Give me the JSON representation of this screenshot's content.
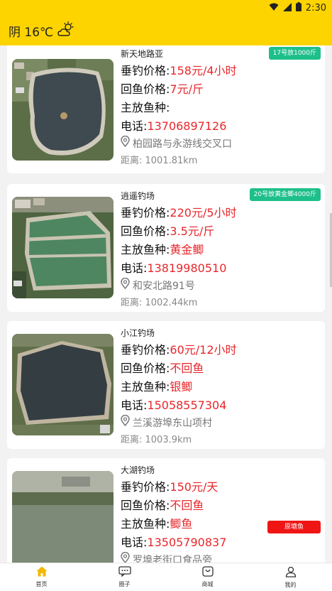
{
  "status_bar": {
    "time": "2:30",
    "icons": [
      "wifi-icon",
      "signal-icon",
      "battery-icon"
    ]
  },
  "header": {
    "weather_text": "阴 16℃",
    "weather_icon": "cloudy-sun-icon",
    "background": "#fdd400"
  },
  "labels": {
    "price_label": "垂钓价格:",
    "return_label": "回鱼价格:",
    "fish_label": "主放鱼种:",
    "phone_label": "电话:",
    "distance_label": "距离: "
  },
  "spots": [
    {
      "name": "新天地路亚",
      "price": "158元/4小时",
      "return_price": "7元/斤",
      "fish": "",
      "phone": "13706897126",
      "address": "柏园路与永游线交叉口",
      "distance": "1001.81km",
      "tag": "17号放1000斤",
      "tag_color": "green"
    },
    {
      "name": "逍遥钓场",
      "price": "220元/5小时",
      "return_price": "3.5元/斤",
      "fish": "黄金鲫",
      "phone": "13819980510",
      "address": "和安北路91号",
      "distance": "1002.44km",
      "tag": "20号放黄金鲫4000斤",
      "tag_color": "green"
    },
    {
      "name": "小江钓场",
      "price": "60元/12小时",
      "return_price": "不回鱼",
      "fish": "银鲫",
      "phone": "15058557304",
      "address": "兰溪游埠东山项村",
      "distance": "1003.9km",
      "tag": "",
      "tag_color": ""
    },
    {
      "name": "大湖钓场",
      "price": "150元/天",
      "return_price": "不回鱼",
      "fish": "鲫鱼",
      "phone": "13505790837",
      "address": "罗埠老街口食品旁",
      "distance": "",
      "tag": "原塘鱼",
      "tag_color": "red"
    }
  ],
  "tabs": [
    {
      "label": "首页",
      "icon": "home-icon",
      "active": true
    },
    {
      "label": "圈子",
      "icon": "chat-icon",
      "active": false
    },
    {
      "label": "商城",
      "icon": "shop-icon",
      "active": false
    },
    {
      "label": "我的",
      "icon": "user-icon",
      "active": false
    }
  ],
  "colors": {
    "accent": "#fdd400",
    "price": "#e8272c",
    "tag_green": "#1dbf8a",
    "tag_red": "#f01515"
  }
}
